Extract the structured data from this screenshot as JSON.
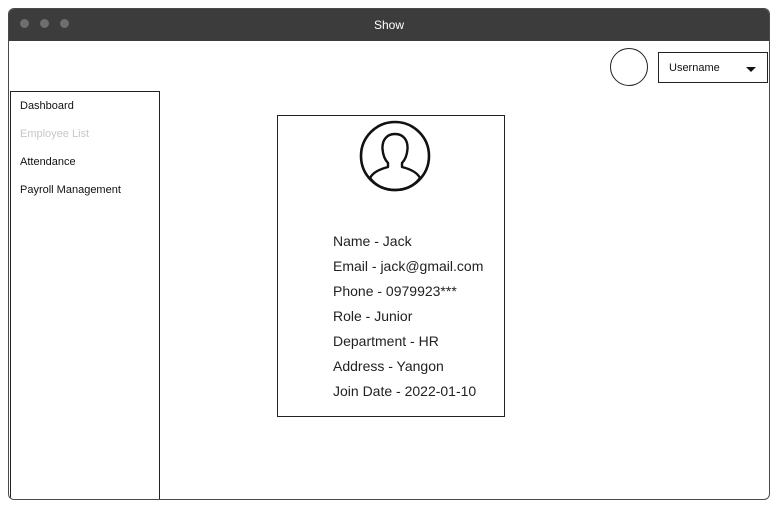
{
  "window": {
    "title": "Show"
  },
  "header": {
    "username_label": "Username",
    "avatar_icon": "avatar-circle",
    "caret_icon": "chevron-down-icon"
  },
  "sidebar": {
    "items": [
      {
        "label": "Dashboard",
        "disabled": false
      },
      {
        "label": "Employee List",
        "disabled": true
      },
      {
        "label": "Attendance",
        "disabled": false
      },
      {
        "label": "Payroll Management",
        "disabled": false
      }
    ]
  },
  "profile": {
    "icon": "user-profile-icon",
    "fields": [
      "Name - Jack",
      "Email - jack@gmail.com",
      "Phone - 0979923***",
      "Role - Junior",
      "Department - HR",
      "Address - Yangon",
      "Join Date - 2022-01-10"
    ]
  }
}
